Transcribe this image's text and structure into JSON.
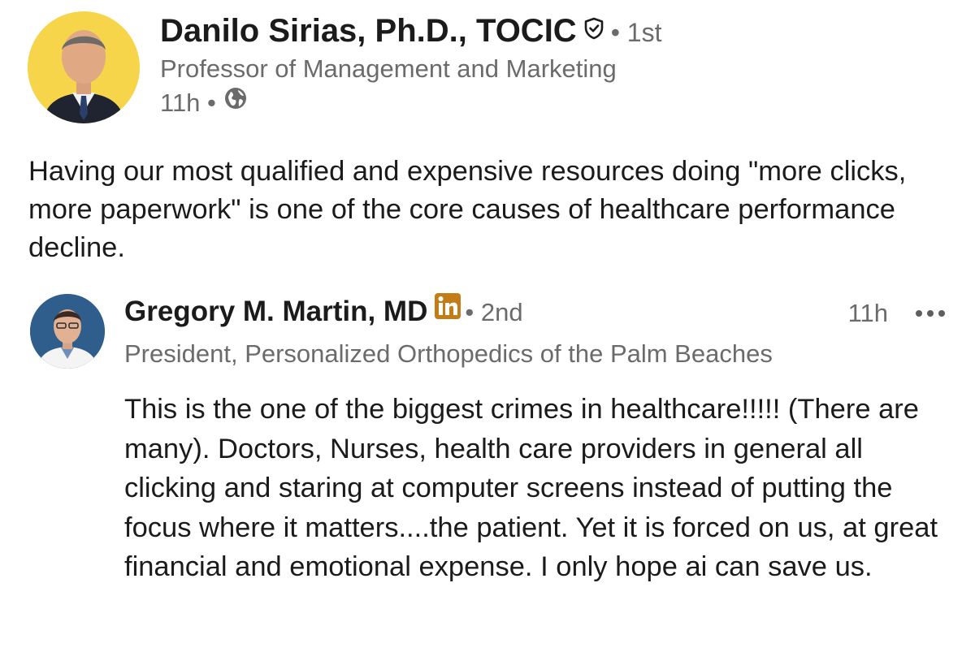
{
  "post": {
    "author": {
      "name": "Danilo Sirias, Ph.D., TOCIC",
      "degree": "• 1st",
      "headline": "Professor of Management and Marketing",
      "time": "11h •"
    },
    "body": "Having our most qualified and expensive resources doing \"more clicks,  more paperwork\" is one of the core causes of healthcare performance decline."
  },
  "comment": {
    "author": {
      "name": "Gregory M. Martin, MD",
      "degree": "• 2nd",
      "headline": "President, Personalized Orthopedics of the Palm Beaches"
    },
    "time": "11h",
    "body": "This is the one of the biggest crimes in healthcare!!!!! (There are many). Doctors, Nurses, health care providers in general all clicking and staring at computer screens instead of putting the focus where it matters....the patient.  Yet it is forced on us, at great financial and emotional expense.  I only hope ai can save us."
  },
  "icons": {
    "verified": "shield-check-icon",
    "visibility": "globe-icon",
    "linkedin_badge": "linkedin-icon",
    "more": "more-options-icon"
  },
  "colors": {
    "text": "#1b1b1b",
    "secondary_text": "#6b6b6b",
    "main_avatar_bg": "#f7d54a",
    "linkedin_badge": "#c37d16"
  }
}
